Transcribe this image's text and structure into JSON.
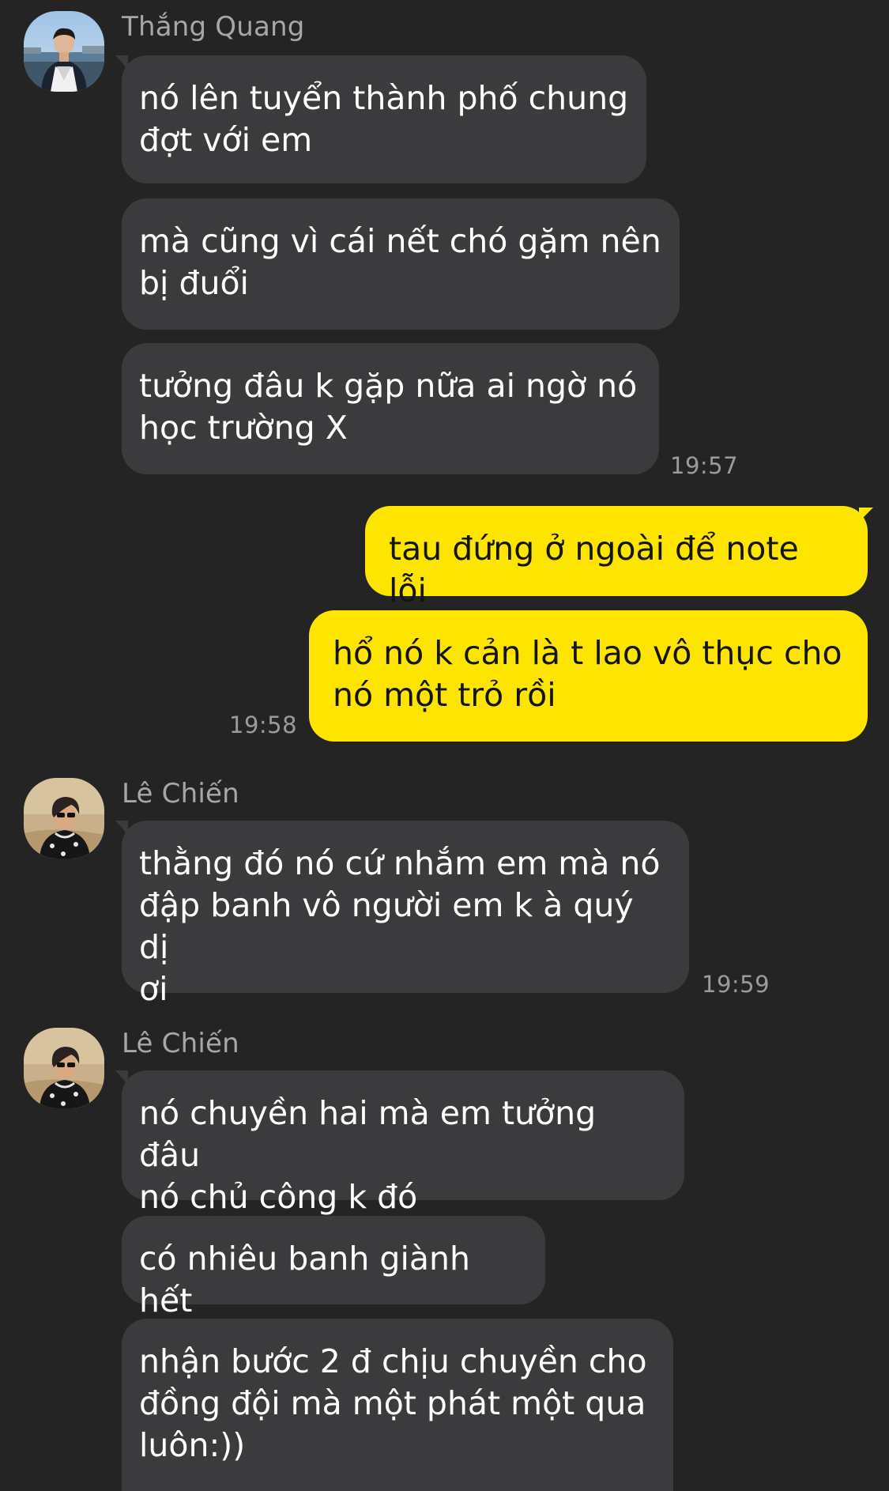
{
  "colors": {
    "background": "#242425",
    "incoming_bubble": "#3b3b3d",
    "outgoing_bubble": "#fee500",
    "sender_text": "#a7a7ab",
    "timestamp_text": "#9b9b9f"
  },
  "messages": [
    {
      "sender": "Thắng Quang",
      "avatar_icon": "profile-photo-icon",
      "bubbles": [
        "nó lên tuyển thành phố chung\nđợt với em",
        "mà cũng vì cái nết chó gặm nên\nbị đuổi",
        "tưởng đâu k gặp nữa ai ngờ nó\nhọc trường X"
      ],
      "time": "19:57"
    },
    {
      "sender": "me",
      "bubbles": [
        "tau đứng ở ngoài để note lỗi",
        "hổ nó k cản là t lao vô thục cho\nnó một trỏ rồi"
      ],
      "time": "19:58"
    },
    {
      "sender": "Lê Chiến",
      "avatar_icon": "profile-photo-icon",
      "bubbles": [
        "thằng đó nó cứ nhắm em mà nó\nđập banh vô người em k à quý dị\nơi"
      ],
      "time": "19:59"
    },
    {
      "sender": "Lê Chiến",
      "avatar_icon": "profile-photo-icon",
      "bubbles": [
        "nó chuyền hai mà em tưởng đâu\nnó chủ công k đó",
        "có nhiêu banh giành hết",
        "nhận bước 2 đ chịu chuyền cho\nđồng đội mà một phát một qua\nluôn:))"
      ]
    }
  ]
}
